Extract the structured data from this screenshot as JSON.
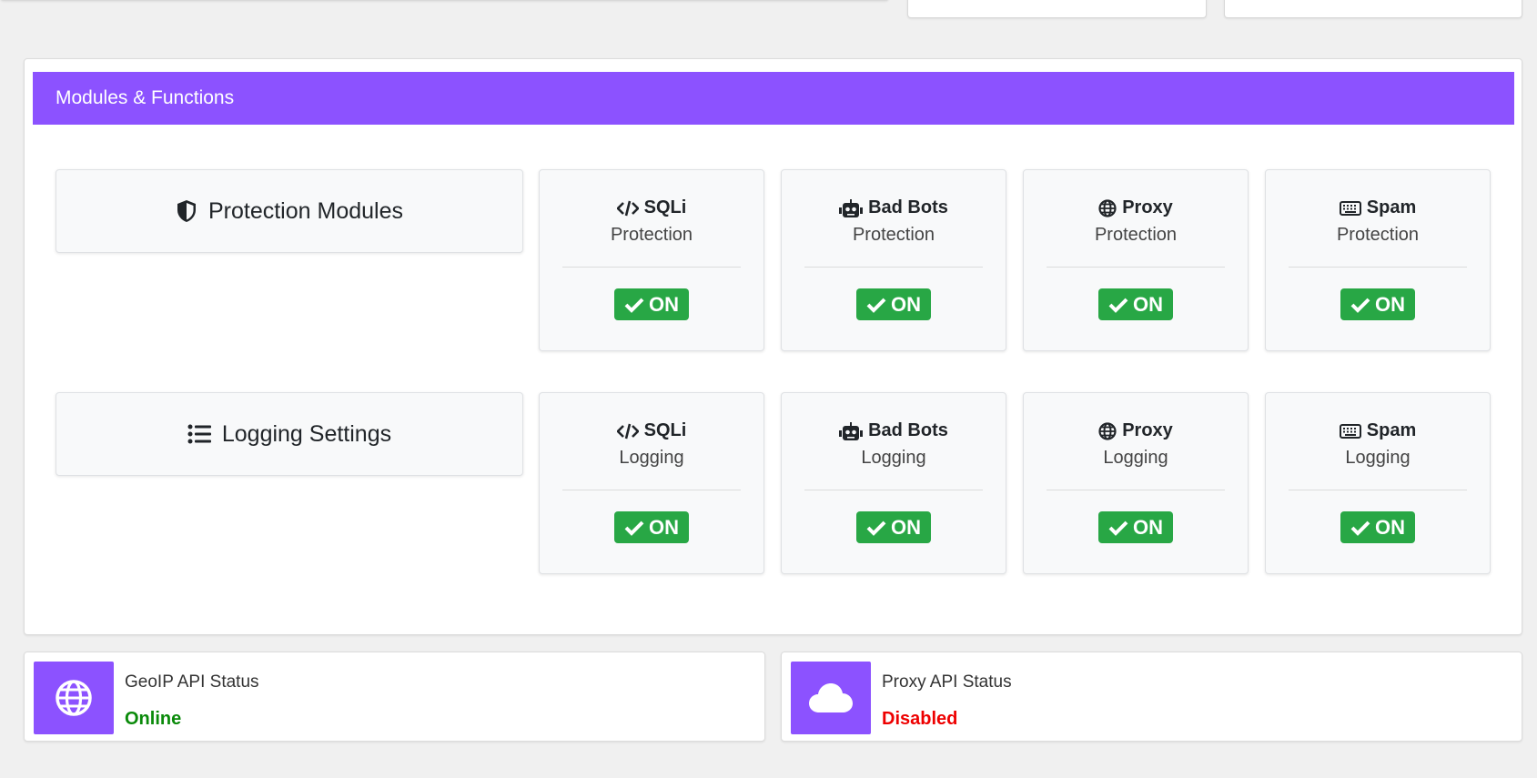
{
  "colors": {
    "accent": "#8c52ff",
    "on_badge": "#28a745",
    "online": "#0a8a0a",
    "disabled": "#ee0000"
  },
  "modules": {
    "header": "Modules & Functions",
    "protection": {
      "label": "Protection Modules",
      "icon": "shield-icon",
      "items": [
        {
          "title": "SQLi",
          "icon": "code-icon",
          "sub": "Protection",
          "status": "ON"
        },
        {
          "title": "Bad Bots",
          "icon": "robot-icon",
          "sub": "Protection",
          "status": "ON"
        },
        {
          "title": "Proxy",
          "icon": "globe-icon",
          "sub": "Protection",
          "status": "ON"
        },
        {
          "title": "Spam",
          "icon": "keyboard-icon",
          "sub": "Protection",
          "status": "ON"
        }
      ]
    },
    "logging": {
      "label": "Logging Settings",
      "icon": "list-icon",
      "items": [
        {
          "title": "SQLi",
          "icon": "code-icon",
          "sub": "Logging",
          "status": "ON"
        },
        {
          "title": "Bad Bots",
          "icon": "robot-icon",
          "sub": "Logging",
          "status": "ON"
        },
        {
          "title": "Proxy",
          "icon": "globe-icon",
          "sub": "Logging",
          "status": "ON"
        },
        {
          "title": "Spam",
          "icon": "keyboard-icon",
          "sub": "Logging",
          "status": "ON"
        }
      ]
    }
  },
  "api": {
    "geoip": {
      "label": "GeoIP API Status",
      "status": "Online",
      "icon": "globe-icon"
    },
    "proxy": {
      "label": "Proxy API Status",
      "status": "Disabled",
      "icon": "cloud-icon"
    }
  }
}
